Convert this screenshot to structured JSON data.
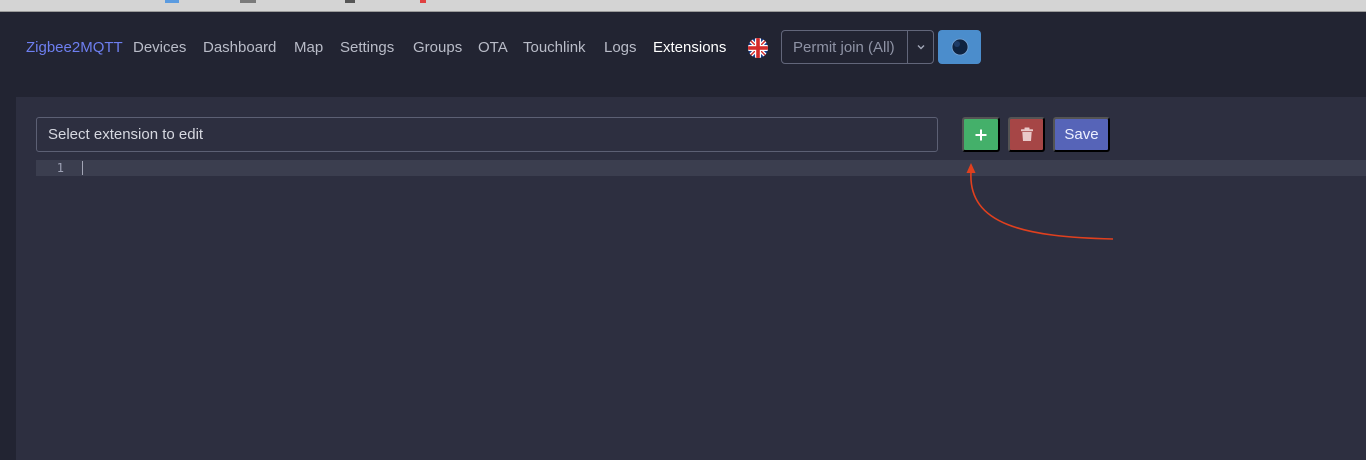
{
  "nav": {
    "brand": "Zigbee2MQTT",
    "links": [
      {
        "label": "Devices"
      },
      {
        "label": "Dashboard"
      },
      {
        "label": "Map"
      },
      {
        "label": "Settings"
      },
      {
        "label": "Groups"
      },
      {
        "label": "OTA"
      },
      {
        "label": "Touchlink"
      },
      {
        "label": "Logs"
      },
      {
        "label": "Extensions",
        "active": true
      }
    ],
    "language_icon": "uk-flag-icon",
    "permit_join_label": "Permit join (All)",
    "theme_icon": "moon-icon"
  },
  "extensions": {
    "select_placeholder": "Select extension to edit",
    "add_icon": "plus-icon",
    "delete_icon": "trash-icon",
    "save_label": "Save",
    "editor": {
      "line_numbers": [
        "1"
      ]
    }
  },
  "colors": {
    "brand": "#6e7ff0",
    "add_button": "#44b06a",
    "delete_button": "#a64646",
    "save_button": "#5664b8",
    "theme_button": "#4b8dcc",
    "annotation_arrow": "#e0401e"
  }
}
